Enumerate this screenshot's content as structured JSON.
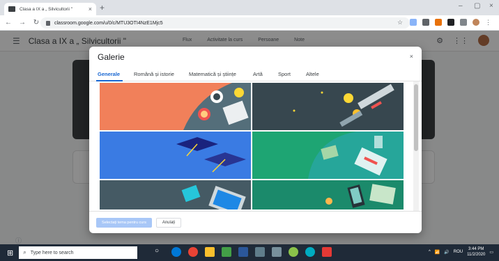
{
  "browser": {
    "tab_title": "Clasa a IX a „ Silvicultorii \"",
    "url": "classroom.google.com/u/0/c/MTU3OTI4NzE1Mjc5",
    "new_tab_icon": "+",
    "close_icon": "×",
    "window_controls": [
      "–",
      "▢",
      "×"
    ]
  },
  "classroom": {
    "title": "Clasa a IX a „ Silvicultorii \"",
    "tabs": [
      "Flux",
      "Activitate la curs",
      "Persoane",
      "Note"
    ]
  },
  "dialog": {
    "title": "Galerie",
    "close_icon": "×",
    "tabs": [
      "Generale",
      "Română și istorie",
      "Matematică și științe",
      "Artă",
      "Sport",
      "Altele"
    ],
    "active_tab": "Generale",
    "tile_colors": [
      "#f1805a",
      "#37474f",
      "#3a7be3",
      "#1ea573",
      "#455a64",
      "#1b8a6b"
    ],
    "select_button": "Selectați tema pentru curs",
    "cancel_button": "Anulați"
  },
  "taskbar": {
    "search_placeholder": "Type here to search",
    "language": "ROU",
    "time": "3:44 PM",
    "date": "11/2/2020"
  }
}
